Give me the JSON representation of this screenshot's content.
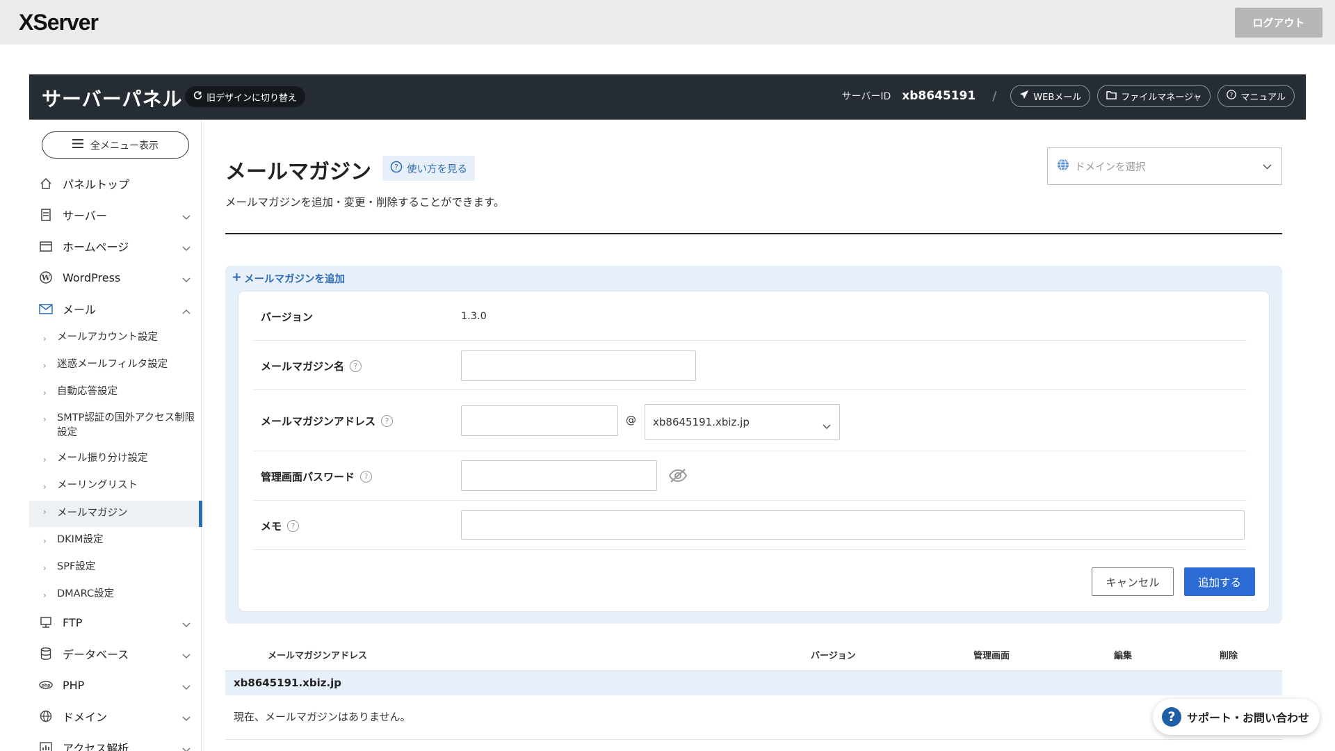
{
  "app": {
    "logo": "XServer",
    "logout_label": "ログアウト"
  },
  "panel": {
    "title": "サーバーパネル",
    "switch_label": "旧デザインに切り替え",
    "server_id_label": "サーバーID",
    "server_id": "xb8645191",
    "slash": "/",
    "links": {
      "webmail": "WEBメール",
      "file_manager": "ファイルマネージャ",
      "manual": "マニュアル"
    }
  },
  "sidebar": {
    "all_menu_label": "全メニュー表示",
    "items": [
      {
        "label": "パネルトップ",
        "icon": "home-icon"
      },
      {
        "label": "サーバー",
        "icon": "server-icon"
      },
      {
        "label": "ホームページ",
        "icon": "browser-icon"
      },
      {
        "label": "WordPress",
        "icon": "wordpress-icon"
      },
      {
        "label": "メール",
        "icon": "mail-icon"
      },
      {
        "label": "FTP",
        "icon": "ftp-icon"
      },
      {
        "label": "データベース",
        "icon": "database-icon"
      },
      {
        "label": "PHP",
        "icon": "php-icon"
      },
      {
        "label": "ドメイン",
        "icon": "globe-icon"
      },
      {
        "label": "アクセス解析",
        "icon": "chart-icon"
      }
    ],
    "mail_sub": [
      "メールアカウント設定",
      "迷惑メールフィルタ設定",
      "自動応答設定",
      "SMTP認証の国外アクセス制限設定",
      "メール振り分け設定",
      "メーリングリスト",
      "メールマガジン",
      "DKIM設定",
      "SPF設定",
      "DMARC設定"
    ],
    "active_sub": "メールマガジン"
  },
  "main": {
    "title": "メールマガジン",
    "howto_label": "使い方を見る",
    "description": "メールマガジンを追加・変更・削除することができます。",
    "domain_select_placeholder": "ドメインを選択",
    "add_link": "メールマガジンを追加",
    "form": {
      "version_label": "バージョン",
      "version_value": "1.3.0",
      "name_label": "メールマガジン名",
      "name_value": "",
      "address_label": "メールマガジンアドレス",
      "address_value": "",
      "at": "@",
      "domain_value": "xb8645191.xbiz.jp",
      "password_label": "管理画面パスワード",
      "password_value": "",
      "memo_label": "メモ",
      "memo_value": "",
      "cancel_label": "キャンセル",
      "submit_label": "追加する"
    },
    "table": {
      "headers": [
        "メールマガジンアドレス",
        "バージョン",
        "管理画面",
        "編集",
        "削除"
      ],
      "group": "xb8645191.xbiz.jp",
      "empty_message": "現在、メールマガジンはありません。"
    }
  },
  "support_label": "サポート・お問い合わせ",
  "colors": {
    "accent": "#2c6bd4",
    "header_dark": "#262c33",
    "highlight": "#e7eff8"
  }
}
